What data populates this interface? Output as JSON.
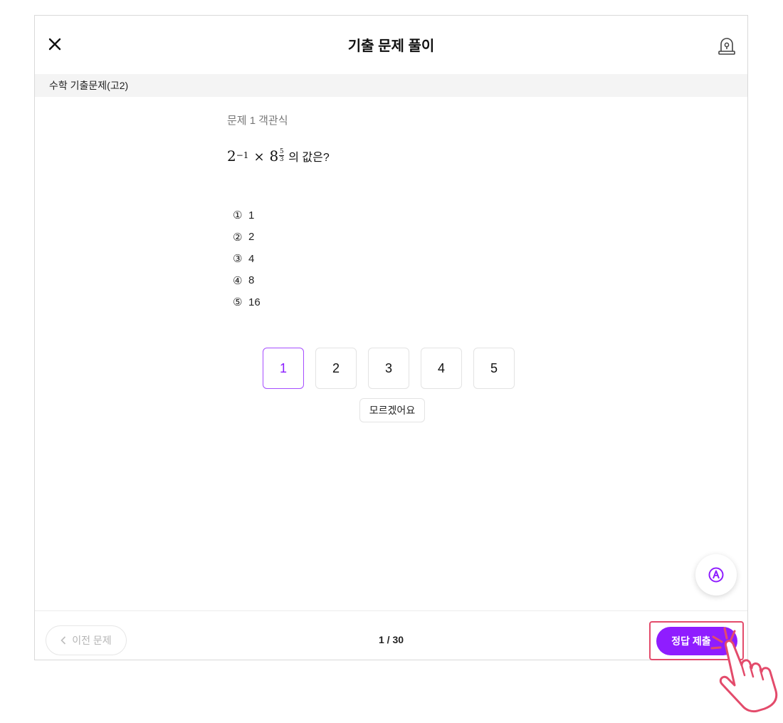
{
  "header": {
    "title": "기출 문제 풀이",
    "close_icon": "close-icon",
    "report_icon": "siren-icon"
  },
  "subbar": {
    "label": "수학 기출문제(고2)"
  },
  "question": {
    "number_label": "문제 1",
    "type_label": "객관식",
    "math": {
      "base1": "2",
      "exp1": "−1",
      "times": "×",
      "base2": "8",
      "exp2_num": "5",
      "exp2_den": "3"
    },
    "text_rest": "의 값은?",
    "choices": [
      {
        "mark": "①",
        "value": "1"
      },
      {
        "mark": "②",
        "value": "2"
      },
      {
        "mark": "③",
        "value": "4"
      },
      {
        "mark": "④",
        "value": "8"
      },
      {
        "mark": "⑤",
        "value": "16"
      }
    ]
  },
  "answers": {
    "options": [
      "1",
      "2",
      "3",
      "4",
      "5"
    ],
    "selected": "1",
    "dont_know_label": "모르겠어요"
  },
  "fab": {
    "icon": "pen-icon"
  },
  "footer": {
    "prev_label": "이전 문제",
    "pager": "1 / 30",
    "submit_label": "정답 제출"
  },
  "colors": {
    "accent": "#8f1dff",
    "highlight": "#e34b6b"
  }
}
